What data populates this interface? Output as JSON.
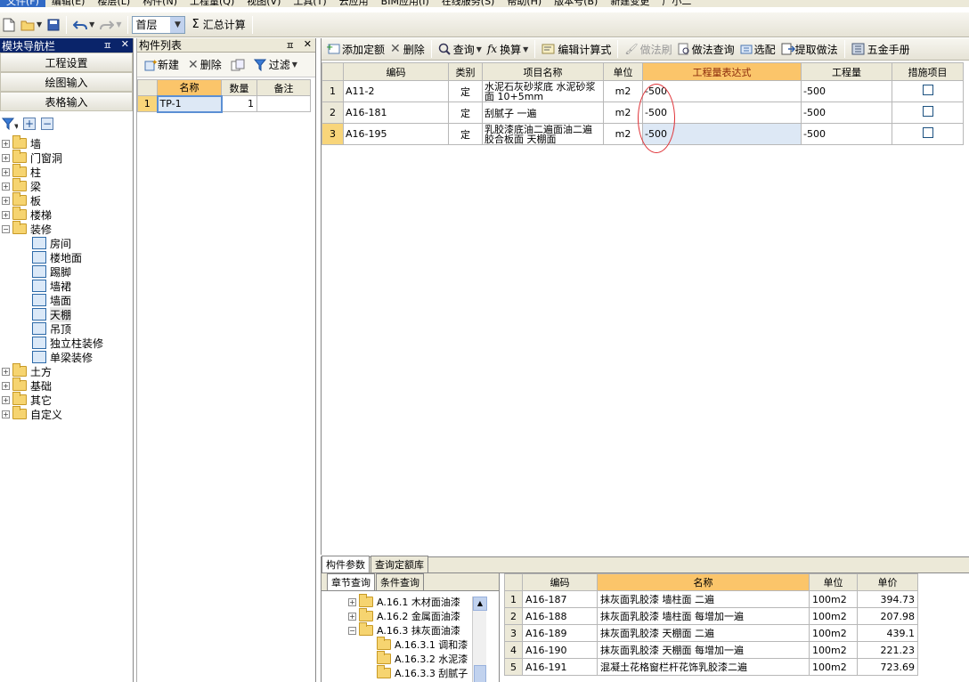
{
  "menu": [
    "文件(F)",
    "编辑(E)",
    "楼层(L)",
    "构件(N)",
    "工程量(Q)",
    "视图(V)",
    "工具(T)",
    "云应用",
    "BIM应用(I)",
    "在线服务(S)",
    "帮助(H)",
    "版本号(B)",
    "新建变更",
    "广小二"
  ],
  "toolbar": {
    "floor": "首层",
    "sum_label": "汇总计算"
  },
  "nav": {
    "title": "模块导航栏",
    "buttons": [
      "工程设置",
      "绘图输入",
      "表格输入"
    ],
    "tree": [
      {
        "label": "墙",
        "exp": "+"
      },
      {
        "label": "门窗洞",
        "exp": "+"
      },
      {
        "label": "柱",
        "exp": "+"
      },
      {
        "label": "梁",
        "exp": "+"
      },
      {
        "label": "板",
        "exp": "+"
      },
      {
        "label": "楼梯",
        "exp": "+"
      },
      {
        "label": "装修",
        "exp": "−"
      }
    ],
    "children": [
      "房间",
      "楼地面",
      "踢脚",
      "墙裙",
      "墙面",
      "天棚",
      "吊顶",
      "独立柱装修",
      "单梁装修"
    ],
    "tree2": [
      {
        "label": "土方",
        "exp": "+"
      },
      {
        "label": "基础",
        "exp": "+"
      },
      {
        "label": "其它",
        "exp": "+"
      },
      {
        "label": "自定义",
        "exp": "+"
      }
    ]
  },
  "complist": {
    "title": "构件列表",
    "new_label": "新建",
    "delete_label": "删除",
    "filter_label": "过滤",
    "columns": [
      "名称",
      "数量",
      "备注"
    ],
    "rows": [
      {
        "n": "1",
        "name": "TP-1",
        "qty": "1",
        "note": ""
      }
    ]
  },
  "main": {
    "toolbar": [
      "添加定额",
      "删除",
      "查询",
      "换算",
      "编辑计算式",
      "做法刷",
      "做法查询",
      "选配",
      "提取做法",
      "五金手册"
    ],
    "columns": [
      "编码",
      "类别",
      "项目名称",
      "单位",
      "工程量表达式",
      "工程量",
      "措施项目"
    ],
    "rows": [
      {
        "n": "1",
        "code": "A11-2",
        "type": "定",
        "name": "水泥石灰砂浆底 水泥砂浆面 10+5mm",
        "unit": "m2",
        "expr": "-500",
        "qty": "-500"
      },
      {
        "n": "2",
        "code": "A16-181",
        "type": "定",
        "name": "刮腻子 一遍",
        "unit": "m2",
        "expr": "-500",
        "qty": "-500"
      },
      {
        "n": "3",
        "code": "A16-195",
        "type": "定",
        "name": "乳胶漆底油二遍面油二遍 胶合板面 天棚面",
        "unit": "m2",
        "expr": "-500",
        "qty": "-500"
      }
    ]
  },
  "bottom": {
    "tabs": [
      "构件参数",
      "查询定额库"
    ],
    "subtabs": [
      "章节查询",
      "条件查询"
    ],
    "chapters": [
      {
        "label": "A.16.1 木材面油漆",
        "exp": "+",
        "level": 1
      },
      {
        "label": "A.16.2 金属面油漆",
        "exp": "+",
        "level": 1
      },
      {
        "label": "A.16.3 抹灰面油漆",
        "exp": "−",
        "level": 1
      },
      {
        "label": "A.16.3.1 调和漆",
        "exp": "",
        "level": 2
      },
      {
        "label": "A.16.3.2 水泥漆",
        "exp": "",
        "level": 2
      },
      {
        "label": "A.16.3.3 刮腻子",
        "exp": "",
        "level": 2
      }
    ],
    "columns": [
      "编码",
      "名称",
      "单位",
      "单价"
    ],
    "rows": [
      {
        "n": "1",
        "code": "A16-187",
        "name": "抹灰面乳胶漆 墙柱面 二遍",
        "unit": "100m2",
        "price": "394.73"
      },
      {
        "n": "2",
        "code": "A16-188",
        "name": "抹灰面乳胶漆 墙柱面 每增加一遍",
        "unit": "100m2",
        "price": "207.98"
      },
      {
        "n": "3",
        "code": "A16-189",
        "name": "抹灰面乳胶漆 天棚面 二遍",
        "unit": "100m2",
        "price": "439.1"
      },
      {
        "n": "4",
        "code": "A16-190",
        "name": "抹灰面乳胶漆 天棚面 每增加一遍",
        "unit": "100m2",
        "price": "221.23"
      },
      {
        "n": "5",
        "code": "A16-191",
        "name": "混凝土花格窗栏杆花饰乳胶漆二遍",
        "unit": "100m2",
        "price": "723.69"
      }
    ]
  }
}
